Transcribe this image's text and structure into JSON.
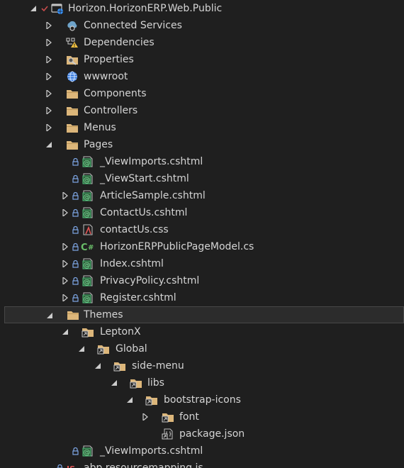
{
  "tree": {
    "project": {
      "label": "Horizon.HorizonERP.Web.Public"
    },
    "items": [
      {
        "label": "Connected Services",
        "icon": "connected-services-icon"
      },
      {
        "label": "Dependencies",
        "icon": "dependencies-warning-icon"
      },
      {
        "label": "Properties",
        "icon": "properties-folder-icon"
      },
      {
        "label": "wwwroot",
        "icon": "globe-icon"
      },
      {
        "label": "Components",
        "icon": "folder-icon"
      },
      {
        "label": "Controllers",
        "icon": "folder-icon"
      },
      {
        "label": "Menus",
        "icon": "folder-icon"
      },
      {
        "label": "Pages",
        "icon": "folder-icon"
      },
      {
        "label": "_ViewImports.cshtml",
        "icon": "cshtml-file-icon"
      },
      {
        "label": "_ViewStart.cshtml",
        "icon": "cshtml-file-icon"
      },
      {
        "label": "ArticleSample.cshtml",
        "icon": "cshtml-file-icon"
      },
      {
        "label": "ContactUs.cshtml",
        "icon": "cshtml-file-icon"
      },
      {
        "label": "contactUs.css",
        "icon": "css-file-icon"
      },
      {
        "label": "HorizonERPPublicPageModel.cs",
        "icon": "csharp-file-icon"
      },
      {
        "label": "Index.cshtml",
        "icon": "cshtml-file-icon"
      },
      {
        "label": "PrivacyPolicy.cshtml",
        "icon": "cshtml-file-icon"
      },
      {
        "label": "Register.cshtml",
        "icon": "cshtml-file-icon"
      },
      {
        "label": "Themes",
        "icon": "folder-icon"
      },
      {
        "label": "LeptonX",
        "icon": "linked-folder-icon"
      },
      {
        "label": "Global",
        "icon": "linked-folder-icon"
      },
      {
        "label": "side-menu",
        "icon": "linked-folder-icon"
      },
      {
        "label": "libs",
        "icon": "linked-folder-icon"
      },
      {
        "label": "bootstrap-icons",
        "icon": "linked-folder-icon"
      },
      {
        "label": "font",
        "icon": "linked-folder-icon"
      },
      {
        "label": "package.json",
        "icon": "linked-json-file-icon"
      },
      {
        "label": "_ViewImports.cshtml",
        "icon": "cshtml-file-icon"
      },
      {
        "label": "abp.resourcemapping.js",
        "icon": "js-file-icon"
      }
    ]
  },
  "colors": {
    "background": "#1f1f1f",
    "selected_row": "#2c2c2c",
    "text": "#d4d4d4",
    "folder": "#dcb67a",
    "cshtml": "#4ec27a",
    "csharp": "#6abf69",
    "git_check": "#c94d4d",
    "lock": "#7ea7e6"
  }
}
